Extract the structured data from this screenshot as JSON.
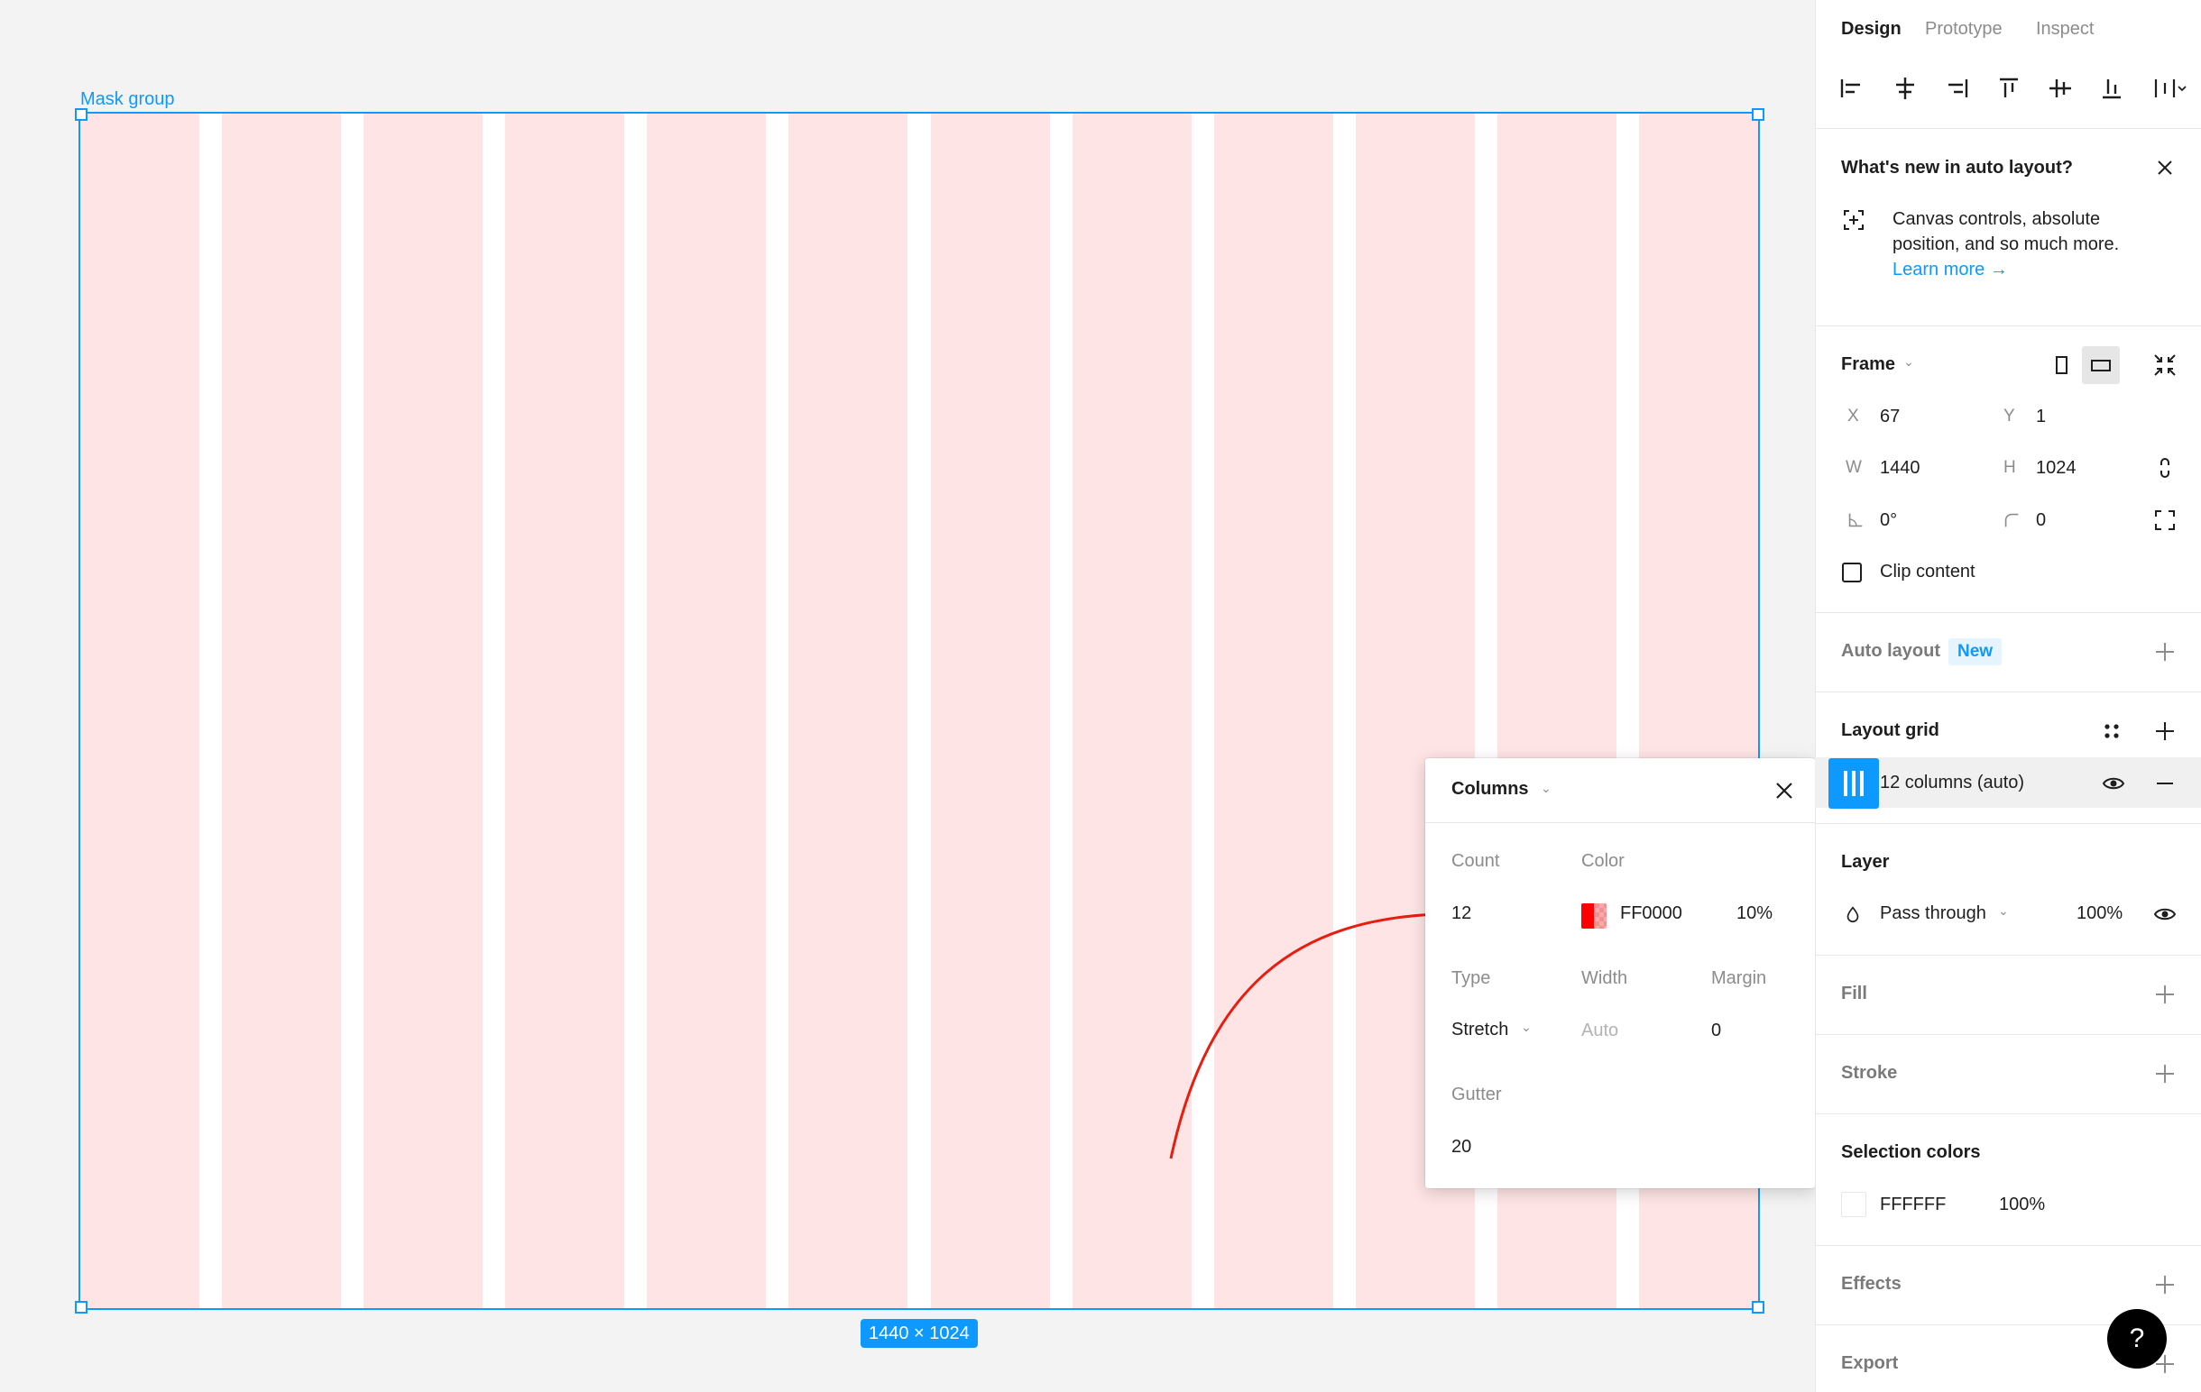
{
  "canvas": {
    "frame_label": "Mask group",
    "size_badge": "1440 × 1024",
    "grid_column_count": 12,
    "grid_color": "#fee4e4",
    "selection_color": "#0d99ff"
  },
  "popover": {
    "title": "Columns",
    "count_label": "Count",
    "count_value": "12",
    "color_label": "Color",
    "color_hex": "FF0000",
    "color_swatch": "#ff0000",
    "color_opacity": "10%",
    "type_label": "Type",
    "type_value": "Stretch",
    "width_label": "Width",
    "width_value": "Auto",
    "margin_label": "Margin",
    "margin_value": "0",
    "gutter_label": "Gutter",
    "gutter_value": "20",
    "arrow_color": "#e51e10"
  },
  "panel": {
    "tabs": [
      "Design",
      "Prototype",
      "Inspect"
    ],
    "whats_new": {
      "title": "What's new in auto layout?",
      "body_line1": "Canvas controls, absolute",
      "body_line2": "position, and so much more.",
      "link": "Learn more →"
    },
    "frame": {
      "title": "Frame",
      "x_label": "X",
      "x_value": "67",
      "y_label": "Y",
      "y_value": "1",
      "w_label": "W",
      "w_value": "1440",
      "h_label": "H",
      "h_value": "1024",
      "rotation_value": "0°",
      "radius_value": "0",
      "clip_label": "Clip content"
    },
    "auto_layout": {
      "title": "Auto layout",
      "badge": "New"
    },
    "layout_grid": {
      "title": "Layout grid",
      "item_label": "12 columns (auto)"
    },
    "layer": {
      "title": "Layer",
      "blend": "Pass through",
      "opacity": "100%"
    },
    "fill": {
      "title": "Fill"
    },
    "stroke": {
      "title": "Stroke"
    },
    "selection_colors": {
      "title": "Selection colors",
      "hex": "FFFFFF",
      "opacity": "100%"
    },
    "effects": {
      "title": "Effects"
    },
    "export": {
      "title": "Export"
    },
    "help": "?",
    "accent": "#0d99ff"
  }
}
